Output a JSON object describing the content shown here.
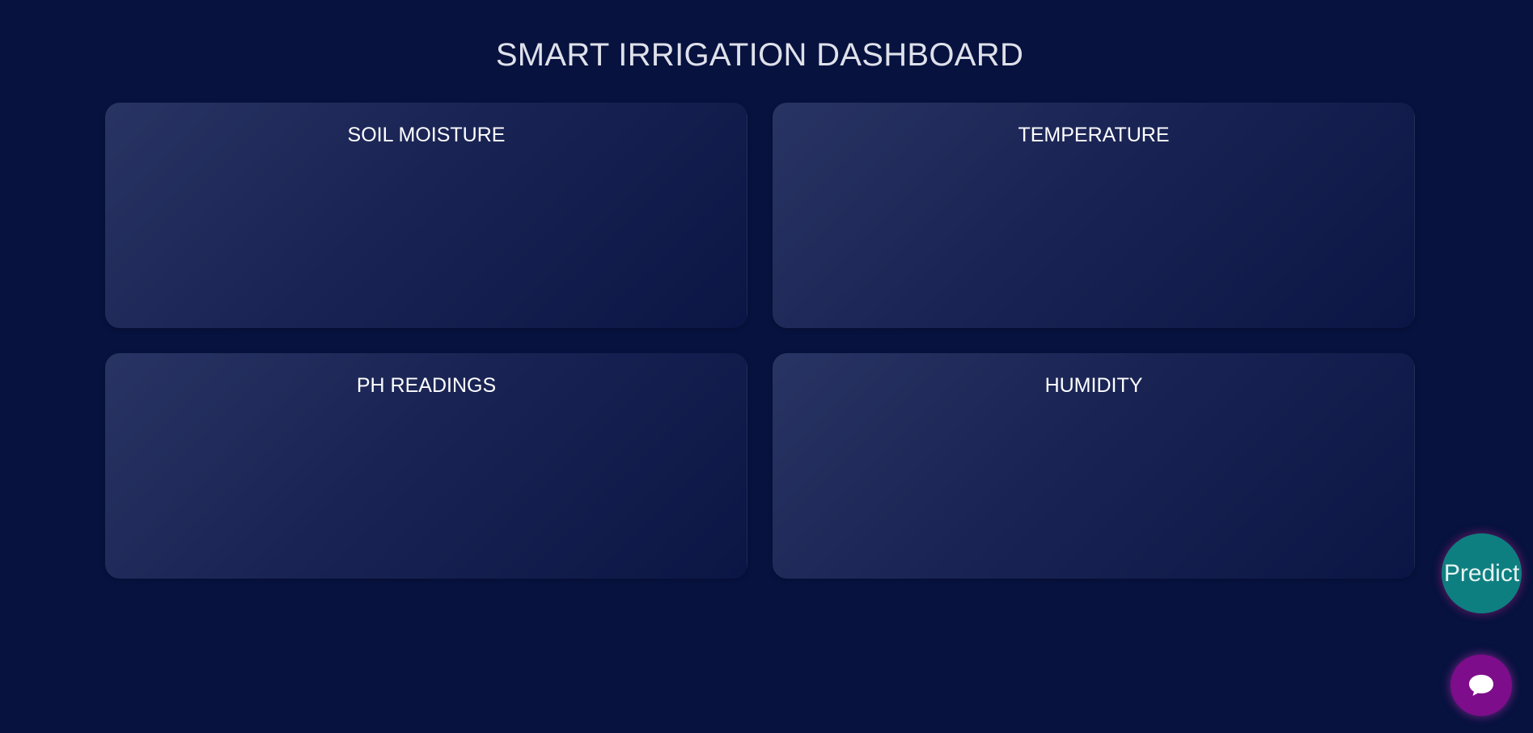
{
  "header": {
    "title": "SMART IRRIGATION DASHBOARD"
  },
  "cards": [
    {
      "title": "SOIL MOISTURE"
    },
    {
      "title": "TEMPERATURE"
    },
    {
      "title": "PH READINGS"
    },
    {
      "title": "HUMIDITY"
    }
  ],
  "actions": {
    "predict_label": "Predict",
    "chat_icon": "chat-bubble-icon"
  },
  "colors": {
    "background": "#07123f",
    "predict_button": "#0e7f80",
    "chat_button": "#7d0d8a"
  }
}
